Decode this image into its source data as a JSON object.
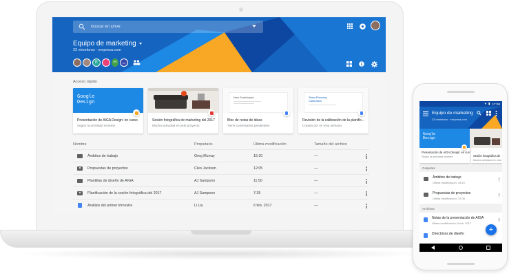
{
  "laptop": {
    "search": {
      "placeholder": "Buscar en Drive"
    },
    "team": {
      "name": "Equipo de marketing",
      "subtitle": "23 miembros · empresa.com",
      "avatars": [
        {
          "initial": "",
          "color": "#8d6e63"
        },
        {
          "initial": "",
          "color": "#a1887f"
        },
        {
          "initial": "E",
          "color": "#26a69a"
        },
        {
          "initial": "",
          "color": "#ec407a"
        },
        {
          "initial": "H",
          "color": "#43a047"
        },
        {
          "initial": "•••",
          "color": "#3949ab"
        }
      ]
    },
    "quick_access": {
      "label": "Acceso rápido",
      "cards": [
        {
          "title": "Presentación de AIGA Design: en curso",
          "subtitle": "Según la actividad reciente",
          "thumb_text": "Google\nDesign"
        },
        {
          "title": "Sesión fotográfica de marketing del 2017",
          "subtitle": "Mucha actividad en este proyecto"
        },
        {
          "title": "Bloc de notas de ideas",
          "subtitle": "Tiene comentarios pendientes",
          "thumb_text": "New Scratchpad"
        },
        {
          "title": "Revisión de la calibración de la planific...",
          "subtitle": "Creado por mí esta semana",
          "thumb_text": "Team Planning\nCalibration"
        }
      ]
    },
    "list": {
      "headers": {
        "name": "Nombre",
        "owner": "Propietario",
        "modified": "Última modificación",
        "size": "Tamaño del archivo"
      },
      "rows": [
        {
          "type": "folder",
          "name": "Ámbitos de trabajo",
          "owner": "Greg Murray",
          "modified": "15:10",
          "size": "—"
        },
        {
          "type": "folder-shared",
          "name": "Propuestas de proyectos",
          "owner": "Cleo Jackson",
          "modified": "12:05",
          "size": "—"
        },
        {
          "type": "folder",
          "name": "Plantillas de diseño de AIGA",
          "owner": "AJ Sampson",
          "modified": "11:50",
          "size": "—"
        },
        {
          "type": "folder-shared",
          "name": "Planificación de la sesión fotográfica del 2017",
          "owner": "AJ Sampson",
          "modified": "7:35",
          "size": "—"
        },
        {
          "type": "doc",
          "name": "Análisis del primer trimestre",
          "owner": "Li Liu",
          "modified": "6 feb. 2017",
          "size": "—"
        }
      ]
    }
  },
  "phone": {
    "status_time": "17:00",
    "team_name": "Equipo de marketing",
    "team_subtitle": "23 miembros · empresa.com",
    "card": {
      "title": "Presentación de AIGA Design: en curso",
      "subtitle": "Según la actividad reciente",
      "thumb_text": "Google\nDesign"
    },
    "card2": {
      "title": "Sesión fotográfica de",
      "subtitle": "Mucha actividad en este"
    },
    "section_folders": "Carpetas",
    "section_files": "Archivos",
    "folders": [
      {
        "name": "Ámbitos de trabajo",
        "meta": "Última modificación: 15:10"
      },
      {
        "name": "Propuestas de proyectos",
        "meta": "Última modificación: 12:05"
      }
    ],
    "files": [
      {
        "name": "Notas de la presentación de AIGA",
        "meta": "Última modificación: 6 feb. 2017"
      },
      {
        "name": "Directrices de diseño",
        "meta": ""
      }
    ],
    "fab_label": "+"
  },
  "colors": {
    "primary": "#1565c0",
    "accent_yellow": "#f9a825",
    "doc_blue": "#4285f4"
  }
}
